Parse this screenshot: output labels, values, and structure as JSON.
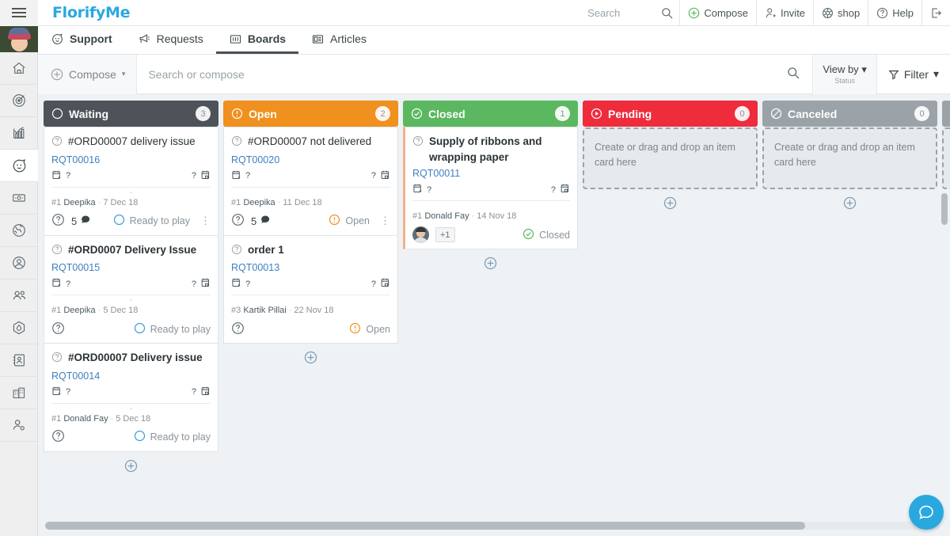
{
  "topbar": {
    "brand": "FlorifyMe",
    "search_placeholder": "Search",
    "items": [
      {
        "label": "Compose",
        "icon": "plus-circle-icon"
      },
      {
        "label": "Invite",
        "icon": "invite-user-icon"
      },
      {
        "label": "shop",
        "icon": "shop-icon"
      },
      {
        "label": "Help",
        "icon": "help-circle-icon"
      },
      {
        "label": "",
        "icon": "logout-icon"
      }
    ]
  },
  "sidebar": {
    "items": [
      {
        "name": "avatar",
        "icon": "user-avatar"
      },
      {
        "name": "home",
        "icon": "home-icon"
      },
      {
        "name": "goals",
        "icon": "target-icon"
      },
      {
        "name": "reports",
        "icon": "chart-icon"
      },
      {
        "name": "support",
        "icon": "face-icon",
        "active": true
      },
      {
        "name": "sales",
        "icon": "money-icon"
      },
      {
        "name": "web",
        "icon": "globe-icon"
      },
      {
        "name": "contacts",
        "icon": "user-circle-icon"
      },
      {
        "name": "teams",
        "icon": "users-icon"
      },
      {
        "name": "marketing",
        "icon": "hexagon-drop-icon"
      },
      {
        "name": "directory",
        "icon": "address-book-icon"
      },
      {
        "name": "companies",
        "icon": "building-icon"
      },
      {
        "name": "settings",
        "icon": "user-cog-icon"
      }
    ]
  },
  "tabs": [
    {
      "label": "Support",
      "icon": "face-icon",
      "active": false,
      "bold": true
    },
    {
      "label": "Requests",
      "icon": "megaphone-icon",
      "active": false,
      "bold": false
    },
    {
      "label": "Boards",
      "icon": "board-icon",
      "active": true,
      "bold": true
    },
    {
      "label": "Articles",
      "icon": "article-icon",
      "active": false,
      "bold": false
    }
  ],
  "toolbar": {
    "compose_label": "Compose",
    "compose_caret": "▾",
    "search_placeholder": "Search or compose",
    "viewby_label": "View by",
    "viewby_caret": "▾",
    "viewby_value": "Status",
    "filter_label": "Filter",
    "filter_caret": "▾"
  },
  "board": {
    "add_card_label": "⊕",
    "dropzone_text": "Create or drag and drop an item card here",
    "columns": [
      {
        "title": "Waiting",
        "count": "3",
        "color": "#4d5358",
        "icon": "circle-outline-icon",
        "cards": [
          {
            "title": "#ORD00007 delivery issue",
            "bold": false,
            "ref": "RQT00016",
            "start_date": "?",
            "end_date": "?",
            "dash": "-",
            "num": "#1",
            "who": "Deepika",
            "date": "7 Dec 18",
            "comments": "5",
            "status": "Ready to play",
            "status_icon": "circle-outline-icon",
            "status_color": "#3b9fd6",
            "kebab": "⋮",
            "accent": false
          },
          {
            "title": "#ORD0007 Delivery Issue",
            "bold": true,
            "ref": "RQT00015",
            "start_date": "?",
            "end_date": "?",
            "dash": "-",
            "num": "#1",
            "who": "Deepika",
            "date": "5 Dec 18",
            "comments": "",
            "status": "Ready to play",
            "status_icon": "circle-outline-icon",
            "status_color": "#3b9fd6",
            "kebab": "",
            "accent": false
          },
          {
            "title": "#ORD00007 Delivery issue",
            "bold": true,
            "ref": "RQT00014",
            "start_date": "?",
            "end_date": "?",
            "dash": "-",
            "num": "#1",
            "who": "Donald Fay",
            "date": "5 Dec 18",
            "comments": "",
            "status": "Ready to play",
            "status_icon": "circle-outline-icon",
            "status_color": "#3b9fd6",
            "kebab": "",
            "accent": false
          }
        ]
      },
      {
        "title": "Open",
        "count": "2",
        "color": "#f0901e",
        "icon": "exclamation-circle-icon",
        "cards": [
          {
            "title": "#ORD00007 not delivered",
            "bold": false,
            "ref": "RQT00020",
            "start_date": "?",
            "end_date": "?",
            "dash": "",
            "num": "#1",
            "who": "Deepika",
            "date": "11 Dec 18",
            "comments": "5",
            "status": "Open",
            "status_icon": "exclamation-circle-icon",
            "status_color": "#f0901e",
            "kebab": "⋮",
            "accent": false
          },
          {
            "title": "order 1",
            "bold": true,
            "ref": "RQT00013",
            "start_date": "?",
            "end_date": "?",
            "dash": "",
            "num": "#3",
            "who": "Kartik Pillai",
            "date": "22 Nov 18",
            "comments": "",
            "status": "Open",
            "status_icon": "exclamation-circle-icon",
            "status_color": "#f0901e",
            "kebab": "",
            "accent": false
          }
        ]
      },
      {
        "title": "Closed",
        "count": "1",
        "color": "#5cb860",
        "icon": "check-circle-icon",
        "cards": [
          {
            "title": "Supply of ribbons and wrapping paper",
            "bold": true,
            "ref": "RQT00011",
            "start_date": "?",
            "end_date": "?",
            "dash": "",
            "num": "#1",
            "who": "Donald Fay",
            "date": "14 Nov 18",
            "comments": "",
            "status": "Closed",
            "status_icon": "check-circle-icon",
            "status_color": "#5cb860",
            "kebab": "",
            "accent": true,
            "avatar": true,
            "extra_members": "+1"
          }
        ]
      },
      {
        "title": "Pending",
        "count": "0",
        "color": "#ee2c3c",
        "icon": "play-circle-icon",
        "cards": [],
        "empty": true
      },
      {
        "title": "Canceled",
        "count": "0",
        "color": "#9ba3a8",
        "icon": "ban-circle-icon",
        "cards": [],
        "empty": true
      }
    ]
  },
  "chat_fab": {
    "icon": "chat-bubble-icon"
  }
}
